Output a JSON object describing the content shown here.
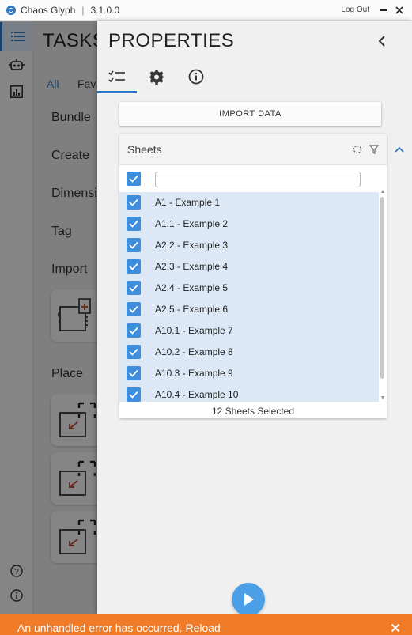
{
  "titlebar": {
    "app_name": "Chaos Glyph",
    "separator": "|",
    "version": "3.1.0.0",
    "logout_label": "Log Out",
    "minimize_glyph": "—",
    "close_glyph": "✕"
  },
  "rail": {
    "items": [
      {
        "icon": "task-list-icon",
        "active": true
      },
      {
        "icon": "robot-icon",
        "active": false
      },
      {
        "icon": "chart-icon",
        "active": false
      }
    ],
    "bottom": [
      {
        "icon": "help-icon"
      },
      {
        "icon": "info-icon"
      }
    ]
  },
  "tasks": {
    "title": "TASKS",
    "tabs": [
      "All",
      "Fav"
    ],
    "active_tab": "All",
    "labels": [
      "Bundle",
      "Create",
      "Dimensi",
      "Tag",
      "Import",
      "Place"
    ]
  },
  "properties": {
    "title": "PROPERTIES",
    "tabs": [
      {
        "icon": "checklist-icon",
        "active": true
      },
      {
        "icon": "gear-icon",
        "active": false
      },
      {
        "icon": "info-icon",
        "active": false
      }
    ],
    "import_button_label": "IMPORT DATA",
    "sheets": {
      "title": "Sheets",
      "filter_value": "",
      "items": [
        {
          "label": "A1 - Example 1",
          "checked": true
        },
        {
          "label": "A1.1 - Example 2",
          "checked": true
        },
        {
          "label": "A2.2 - Example 3",
          "checked": true
        },
        {
          "label": "A2.3 - Example 4",
          "checked": true
        },
        {
          "label": "A2.4 - Example 5",
          "checked": true
        },
        {
          "label": "A2.5 - Example 6",
          "checked": true
        },
        {
          "label": "A10.1 - Example 7",
          "checked": true
        },
        {
          "label": "A10.2 - Example 8",
          "checked": true
        },
        {
          "label": "A10.3 - Example 9",
          "checked": true
        },
        {
          "label": "A10.4 - Example 10",
          "checked": true
        }
      ],
      "selected_status": "12 Sheets Selected"
    }
  },
  "error": {
    "message": "An unhandled error has occurred.",
    "reload_label": "Reload",
    "close_glyph": "✕"
  },
  "colors": {
    "accent": "#2f78c4",
    "checkbox": "#3d8edc",
    "error_bar": "#f07b28",
    "run_button": "#4a9fe6"
  }
}
